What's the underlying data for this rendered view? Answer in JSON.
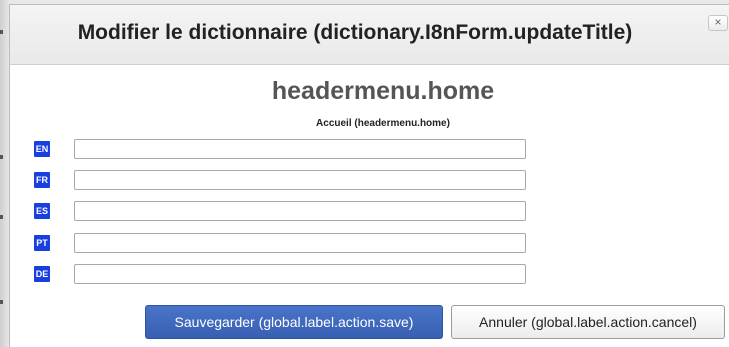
{
  "dialog": {
    "title": "Modifier le dictionnaire (dictionary.I8nForm.updateTitle)",
    "close_glyph": "×"
  },
  "entry": {
    "key_title": "headermenu.home",
    "subtitle": "Accueil (headermenu.home)"
  },
  "languages": [
    {
      "code": "EN",
      "value": ""
    },
    {
      "code": "FR",
      "value": ""
    },
    {
      "code": "ES",
      "value": ""
    },
    {
      "code": "PT",
      "value": ""
    },
    {
      "code": "DE",
      "value": ""
    }
  ],
  "actions": {
    "save_label": "Sauvegarder (global.label.action.save)",
    "cancel_label": "Annuler (global.label.action.cancel)"
  },
  "colors": {
    "badge": "#1a3fe0",
    "save_button": "#3f69be",
    "title_text": "#222222",
    "key_title_text": "#555555"
  }
}
